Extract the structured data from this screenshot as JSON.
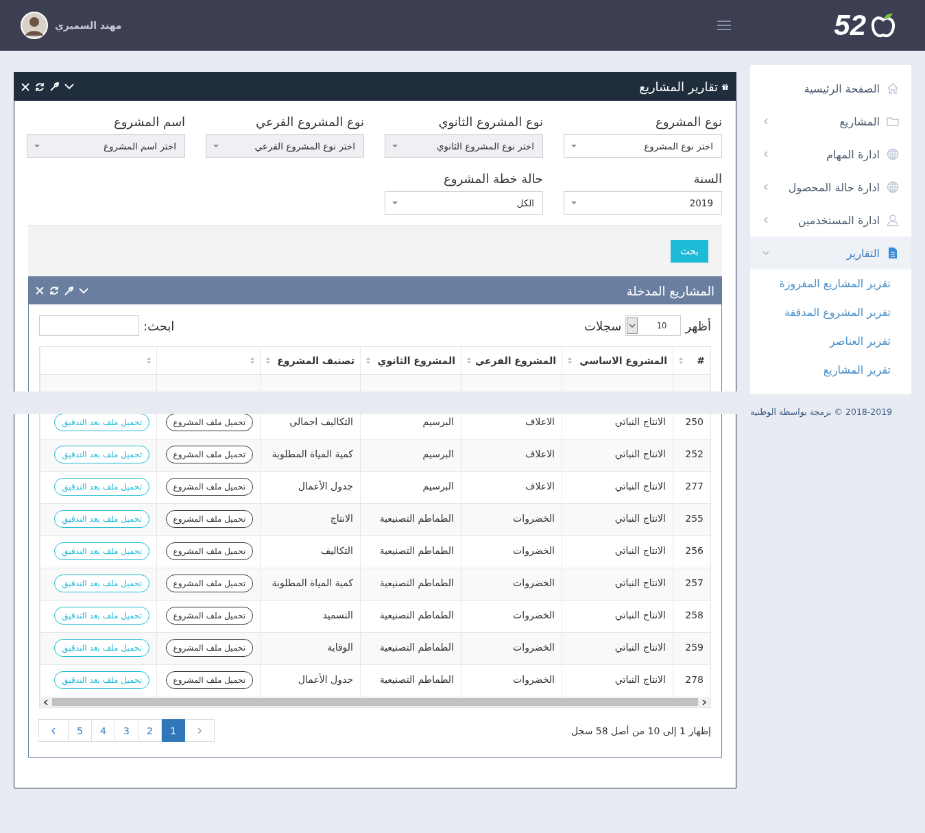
{
  "header": {
    "logo_text": "52",
    "user_name": "مهند السميري"
  },
  "sidebar": {
    "items": [
      {
        "label": "الصفحة الرئيسية",
        "selected": false
      },
      {
        "label": "المشاريع",
        "expanded": false,
        "selected": false
      },
      {
        "label": "ادارة المهام",
        "expanded": false,
        "selected": false
      },
      {
        "label": "ادارة حالة المحصول",
        "expanded": false,
        "selected": false
      },
      {
        "label": "ادارة المستخدمين",
        "expanded": false,
        "selected": false
      },
      {
        "label": "التقارير",
        "expanded": true,
        "selected": true,
        "children": [
          {
            "label": "تقرير المشاريع المفروزة"
          },
          {
            "label": "تقرير المشروع المدققة"
          },
          {
            "label": "تقرير العناصر"
          },
          {
            "label": "تقرير المشاريع"
          }
        ]
      }
    ]
  },
  "footer": "2018-2019 © برمجة بواسطة الوطنية",
  "reports_panel": {
    "title": "تقارير المشاريع",
    "filters": [
      {
        "label": "نوع المشروع",
        "value": "اختر نوع المشروع",
        "disabled": false
      },
      {
        "label": "نوع المشروع الثانوي",
        "value": "اختر نوع المشروع الثانوي",
        "disabled": true
      },
      {
        "label": "نوع المشروع الفرعي",
        "value": "اختر نوع المشروع الفرعي",
        "disabled": true
      },
      {
        "label": "اسم المشروع",
        "value": "اختر اسم المشروع",
        "disabled": true
      },
      {
        "label": "السنة",
        "value": "2019",
        "disabled": false
      },
      {
        "label": "حالة خطة المشروع",
        "value": "الكل",
        "disabled": false
      }
    ],
    "search_button": "بحث"
  },
  "projects_panel": {
    "title": "المشاريع المدخلة",
    "show_label": "أظهر",
    "page_size": "10",
    "records_label": "سجلات",
    "search_label": "ابحث:",
    "table": {
      "columns": [
        "#",
        "المشروع الاساسي",
        "المشروع الفرعي",
        "المشروع الثانوي",
        "تصنيف المشروع"
      ],
      "rows": [
        {
          "cells": [
            "250",
            "الانتاج النباتي",
            "الاعلاف",
            "البرسيم",
            "التكاليف اجمالى"
          ],
          "file_button": "تحميل ملف المشروع",
          "audit_button": "تحميل ملف بعد التدقيق"
        },
        {
          "cells": [
            "252",
            "الانتاج النباتي",
            "الاعلاف",
            "البرسيم",
            "كمية المياة المطلوبة"
          ],
          "file_button": "تحميل ملف المشروع",
          "audit_button": "تحميل ملف بعد التدقيق"
        },
        {
          "cells": [
            "277",
            "الانتاج النباتي",
            "الاعلاف",
            "البرسيم",
            "جدول الأعمال"
          ],
          "file_button": "تحميل ملف المشروع",
          "audit_button": "تحميل ملف بعد التدقيق"
        },
        {
          "cells": [
            "255",
            "الانتاج النباتي",
            "الخضروات",
            "الطماطم التصنيعية",
            "الانتاج"
          ],
          "file_button": "تحميل ملف المشروع",
          "audit_button": "تحميل ملف بعد التدقيق"
        },
        {
          "cells": [
            "256",
            "الانتاج النباتي",
            "الخضروات",
            "الطماطم التصنيعية",
            "التكاليف"
          ],
          "file_button": "تحميل ملف المشروع",
          "audit_button": "تحميل ملف بعد التدقيق"
        },
        {
          "cells": [
            "257",
            "الانتاج النباتي",
            "الخضروات",
            "الطماطم التصنيعية",
            "كمية المياة المطلوبة"
          ],
          "file_button": "تحميل ملف المشروع",
          "audit_button": "تحميل ملف بعد التدقيق"
        },
        {
          "cells": [
            "258",
            "الانتاج النباتي",
            "الخضروات",
            "الطماطم التصنيعية",
            "التسميد"
          ],
          "file_button": "تحميل ملف المشروع",
          "audit_button": "تحميل ملف بعد التدقيق"
        },
        {
          "cells": [
            "259",
            "الانتاج النباتي",
            "الخضروات",
            "الطماطم التصنيعية",
            "الوقاية"
          ],
          "file_button": "تحميل ملف المشروع",
          "audit_button": "تحميل ملف بعد التدقيق"
        },
        {
          "cells": [
            "278",
            "الانتاج النباتي",
            "الخضروات",
            "الطماطم التصنيعية",
            "جدول الأعمال"
          ],
          "file_button": "تحميل ملف المشروع",
          "audit_button": "تحميل ملف بعد التدقيق"
        }
      ]
    },
    "info": "إظهار 1 إلى 10 من أصل 58 سجل",
    "pages": [
      {
        "label": "1",
        "selected": true
      },
      {
        "label": "2",
        "selected": false
      },
      {
        "label": "3",
        "selected": false
      },
      {
        "label": "4",
        "selected": false
      },
      {
        "label": "5",
        "selected": false
      }
    ]
  }
}
